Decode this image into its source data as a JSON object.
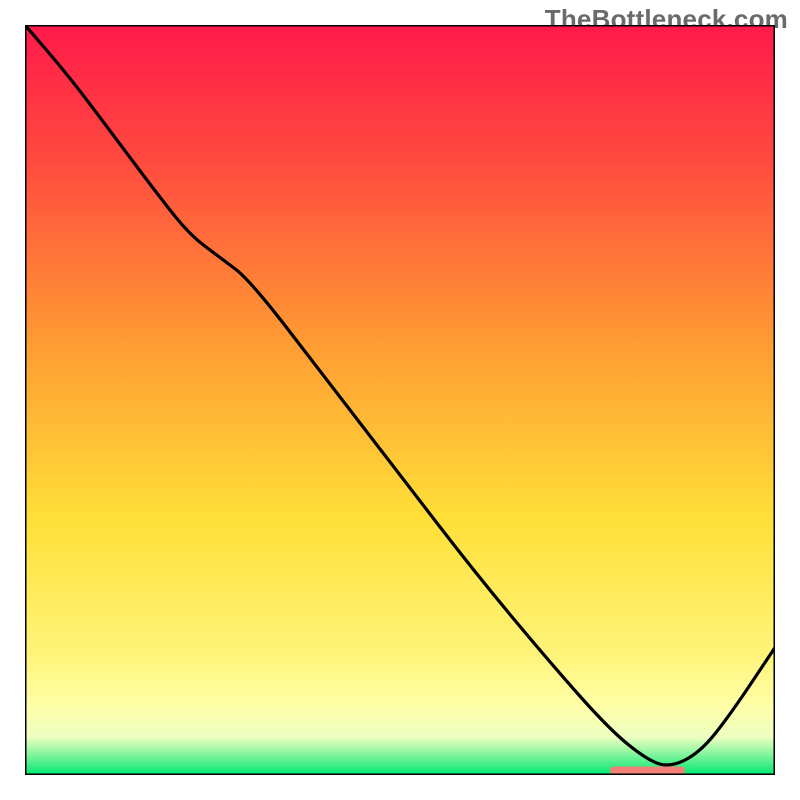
{
  "watermark": "TheBottleneck.com",
  "colors": {
    "gradient_top": "#ff1a4a",
    "gradient_mid_red": "#ff4a3f",
    "gradient_mid_orange": "#ff9a33",
    "gradient_mid_yellow": "#ffe038",
    "gradient_lower_yellow": "#fff47a",
    "gradient_pale_yellow": "#ffffa9",
    "gradient_band": "#ecffc0",
    "gradient_bottom": "#00e871",
    "curve": "#000000",
    "marker": "#f08078",
    "frame": "#000000"
  },
  "chart_data": {
    "type": "line",
    "title": "",
    "xlabel": "",
    "ylabel": "",
    "xlim": [
      0,
      100
    ],
    "ylim": [
      0,
      100
    ],
    "x": [
      0,
      6,
      12,
      18,
      22,
      26,
      30,
      40,
      50,
      60,
      70,
      78,
      83,
      86,
      90,
      94,
      100
    ],
    "values": [
      100,
      93,
      85,
      77,
      72,
      69,
      66,
      53,
      40,
      27,
      15,
      6,
      2,
      1,
      3,
      8,
      17
    ],
    "marker_segment": {
      "x_start": 78,
      "x_end": 88,
      "y": 0.6
    }
  }
}
